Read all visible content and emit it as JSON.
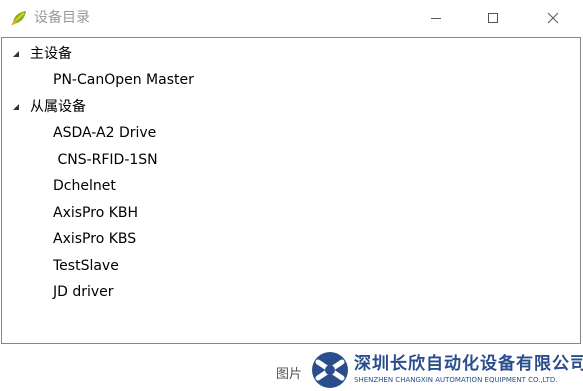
{
  "window": {
    "title": "设备目录",
    "icon": "leaf-app-icon",
    "controls": [
      "minimize-icon",
      "maximize-icon",
      "close-icon"
    ]
  },
  "tree": {
    "groups": [
      {
        "label": "主设备",
        "expanded": true,
        "children": [
          "PN-CanOpen Master"
        ]
      },
      {
        "label": "从属设备",
        "expanded": true,
        "children": [
          "ASDA-A2 Drive",
          " CNS-RFID-1SN",
          "Dchelnet",
          "AxisPro KBH",
          "AxisPro KBS",
          "TestSlave",
          "JD driver"
        ]
      }
    ]
  },
  "footer": {
    "caption": "图片",
    "watermark_name": "深圳长欣自动化设备有限公司",
    "watermark_sub": "SHENZHEN CHANGXIN AUTOMATION EQUIPMENT CO.,LTD.",
    "brand_color": "#2a4e8c"
  }
}
